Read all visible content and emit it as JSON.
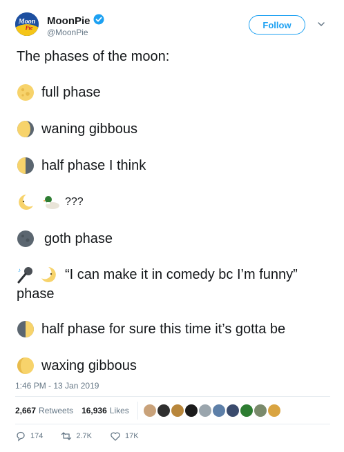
{
  "user": {
    "display_name": "MoonPie",
    "handle": "@MoonPie",
    "avatar_text_1": "Moon",
    "avatar_text_2": "Pie"
  },
  "follow_label": "Follow",
  "tweet": {
    "intro": "The phases of the moon:",
    "phases": [
      {
        "icon": "full-moon-icon",
        "text": "full phase"
      },
      {
        "icon": "waning-gibbous-icon",
        "text": "waning gibbous"
      },
      {
        "icon": "half-moon-icon",
        "text": "half phase I think"
      },
      {
        "icon": "crescent-face-icon",
        "text": "???"
      },
      {
        "icon": "new-moon-icon",
        "text": "goth phase"
      },
      {
        "icon": "crescent-face-icon",
        "text": "“I can make it in comedy bc I’m funny”",
        "text2": "phase"
      },
      {
        "icon": "first-quarter-icon",
        "text": "half phase for sure this time it’s gotta be"
      },
      {
        "icon": "waxing-gibbous-icon",
        "text": "waxing gibbous"
      }
    ]
  },
  "timestamp": "1:46 PM - 13 Jan 2019",
  "stats": {
    "retweets_count": "2,667",
    "retweets_label": "Retweets",
    "likes_count": "16,936",
    "likes_label": "Likes"
  },
  "actions": {
    "replies": "174",
    "retweets": "2.7K",
    "likes": "17K"
  },
  "colors": {
    "accent": "#1da1f2",
    "moon_yellow": "#f7d36b",
    "moon_dark": "#5b6670"
  }
}
